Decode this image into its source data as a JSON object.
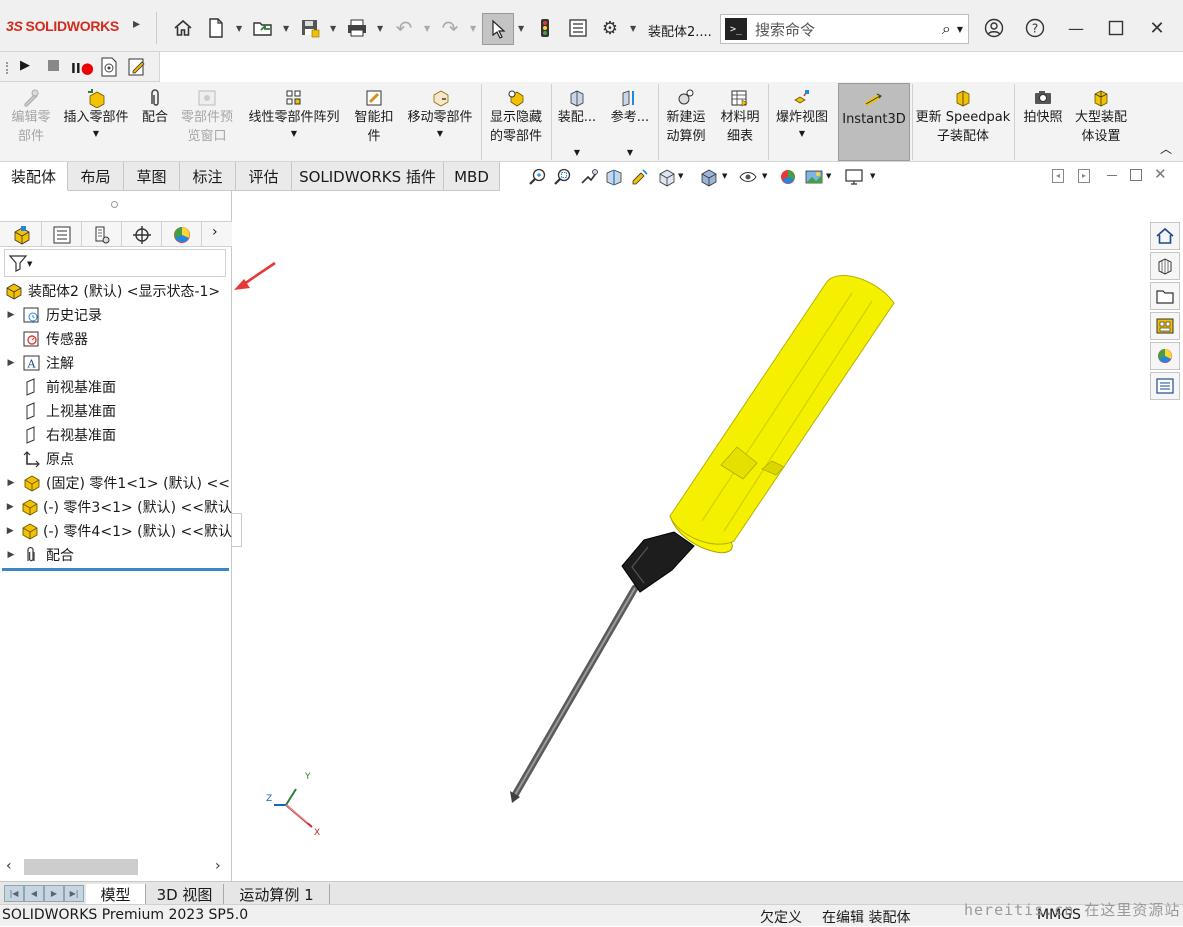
{
  "app": {
    "brand_prefix": "3S",
    "brand_name": "SOLIDWORKS",
    "doc_title": "装配体2....",
    "search_placeholder": "搜索命令",
    "accent": "#d52b1e"
  },
  "titlebar_icons": [
    "home-icon",
    "new-doc-icon",
    "open-icon",
    "save-icon",
    "print-icon",
    "undo-icon",
    "redo-icon",
    "select-cursor-icon",
    "traffic-light-icon",
    "options-list-icon",
    "gear-icon"
  ],
  "window_controls": [
    "user-icon",
    "help-icon",
    "minimize-icon",
    "maximize-icon",
    "close-icon"
  ],
  "macro_icons": [
    "play-icon",
    "stop-icon",
    "record-icon",
    "macro-new-icon",
    "macro-edit-icon"
  ],
  "ribbon": {
    "edit_component": "编辑零\n部件",
    "insert_components": "插入零部件",
    "mate": "配合",
    "component_preview": "零部件预\n览窗口",
    "linear_pattern": "线性零部件阵列",
    "smart_fasteners": "智能扣\n件",
    "move_component": "移动零部件",
    "show_hidden": "显示隐藏\n的零部件",
    "assembly_features": "装配...",
    "reference": "参考...",
    "new_motion_study": "新建运\n动算例",
    "bom": "材料明\n细表",
    "exploded_view": "爆炸视图",
    "instant3d": "Instant3D",
    "update_speedpak": "更新 Speedpak\n子装配体",
    "snapshot": "拍快照",
    "large_assembly": "大型装配\n体设置"
  },
  "tabs": [
    "装配体",
    "布局",
    "草图",
    "标注",
    "评估",
    "SOLIDWORKS 插件",
    "MBD"
  ],
  "tree": {
    "root": "装配体2 (默认) <显示状态-1>",
    "items": [
      {
        "label": "历史记录",
        "expand": true,
        "icon": "history-icon"
      },
      {
        "label": "传感器",
        "expand": false,
        "icon": "sensor-icon"
      },
      {
        "label": "注解",
        "expand": true,
        "icon": "annotation-icon"
      },
      {
        "label": "前视基准面",
        "expand": false,
        "icon": "plane-icon"
      },
      {
        "label": "上视基准面",
        "expand": false,
        "icon": "plane-icon"
      },
      {
        "label": "右视基准面",
        "expand": false,
        "icon": "plane-icon"
      },
      {
        "label": "原点",
        "expand": false,
        "icon": "origin-icon"
      },
      {
        "label": "(固定) 零件1<1> (默认) <<",
        "expand": true,
        "icon": "part-icon"
      },
      {
        "label": "(-) 零件3<1> (默认) <<默认",
        "expand": true,
        "icon": "part-icon"
      },
      {
        "label": "(-) 零件4<1> (默认) <<默认",
        "expand": true,
        "icon": "part-icon"
      },
      {
        "label": "配合",
        "expand": true,
        "icon": "mates-icon"
      }
    ]
  },
  "bottom_tabs": [
    "模型",
    "3D 视图",
    "运动算例 1"
  ],
  "status": {
    "product": "SOLIDWORKS Premium 2023 SP5.0",
    "definition": "欠定义",
    "editing": "在编辑 装配体",
    "units": "MMGS",
    "watermark": "hereitis.cn 在这里资源站"
  },
  "triad": {
    "x": "X",
    "y": "Y",
    "z": "Z"
  }
}
